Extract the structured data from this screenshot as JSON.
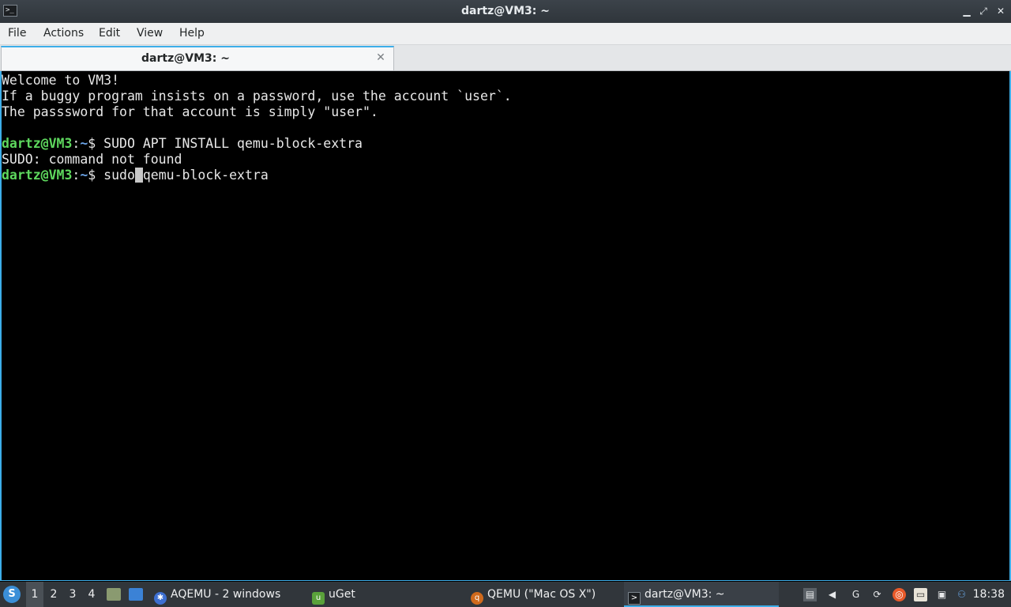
{
  "window": {
    "title": "dartz@VM3: ~",
    "app_icon_glyph": ">_",
    "minimize_glyph": "▁",
    "maximize_glyph": "⤢",
    "close_glyph": "✕"
  },
  "menubar": {
    "items": [
      "File",
      "Actions",
      "Edit",
      "View",
      "Help"
    ]
  },
  "tabs": [
    {
      "label": "dartz@VM3: ~",
      "close_glyph": "✕",
      "active": true
    }
  ],
  "terminal": {
    "welcome_lines": [
      "Welcome to VM3!",
      "If a buggy program insists on a password, use the account `user`.",
      "The passsword for that account is simply \"user\"."
    ],
    "prompt_user": "dartz@VM3",
    "prompt_sep": ":",
    "prompt_path": "~",
    "prompt_symbol": "$ ",
    "command1": "SUDO APT INSTALL qemu-block-extra",
    "output1": "SUDO: command not found",
    "command2_before_cursor": "sudo",
    "command2_cursor_char": " ",
    "command2_after_cursor": "qemu-block-extra"
  },
  "taskbar": {
    "start_icon": "start-menu-icon",
    "desktops": [
      "1",
      "2",
      "3",
      "4"
    ],
    "active_desktop": "1",
    "tasks": [
      {
        "label": "AQEMU - 2 windows",
        "icon": "aqemu-icon"
      },
      {
        "label": "uGet",
        "icon": "uget-icon"
      },
      {
        "label": "QEMU (\"Mac OS X\")",
        "icon": "qemu-icon"
      },
      {
        "label": "dartz@VM3: ~",
        "icon": "terminal-icon"
      }
    ],
    "clock": "18:38"
  },
  "colors": {
    "accent": "#3daee9",
    "prompt_user": "#5ed85e",
    "prompt_path": "#6ba4e8",
    "panel_bg": "#31363b"
  }
}
